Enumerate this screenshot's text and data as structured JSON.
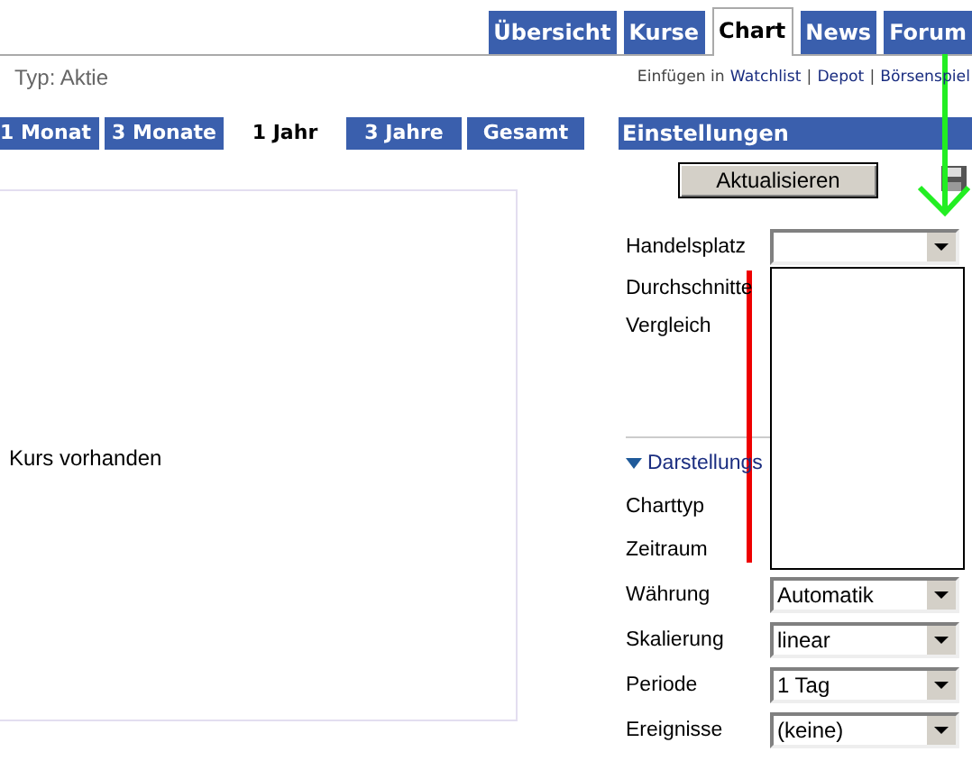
{
  "top_tabs": [
    {
      "label": "Übersicht",
      "selected": false
    },
    {
      "label": "Kurse",
      "selected": false
    },
    {
      "label": "Chart",
      "selected": true
    },
    {
      "label": "News",
      "selected": false
    },
    {
      "label": "Forum",
      "selected": false
    }
  ],
  "type_label": "Typ: Aktie",
  "insert_links": {
    "prefix": "Einfügen in",
    "separator": "|",
    "items": [
      "Watchlist",
      "Depot",
      "Börsenspiel"
    ]
  },
  "period_tabs": [
    {
      "label": "1 Monat",
      "selected": false
    },
    {
      "label": "3 Monate",
      "selected": false
    },
    {
      "label": "1 Jahr",
      "selected": true
    },
    {
      "label": "3 Jahre",
      "selected": false
    },
    {
      "label": "Gesamt",
      "selected": false
    }
  ],
  "chart": {
    "message": "Kurs vorhanden"
  },
  "settings": {
    "title": "Einstellungen",
    "update_button": "Aktualisieren",
    "rows": [
      {
        "label": "Handelsplatz",
        "kind": "select_open"
      },
      {
        "label": "Durchschnitte",
        "kind": "label"
      },
      {
        "label": "Vergleich",
        "kind": "label"
      }
    ],
    "section": {
      "title": "Darstellungs",
      "expanded": true,
      "rows": [
        {
          "label": "Charttyp",
          "kind": "label"
        },
        {
          "label": "Zeitraum",
          "kind": "label"
        },
        {
          "label": "Währung",
          "kind": "select",
          "value": "Automatik"
        },
        {
          "label": "Skalierung",
          "kind": "select",
          "value": "linear"
        },
        {
          "label": "Periode",
          "kind": "select",
          "value": "1 Tag"
        },
        {
          "label": "Ereignisse",
          "kind": "select",
          "value": "(keine)"
        }
      ]
    }
  }
}
